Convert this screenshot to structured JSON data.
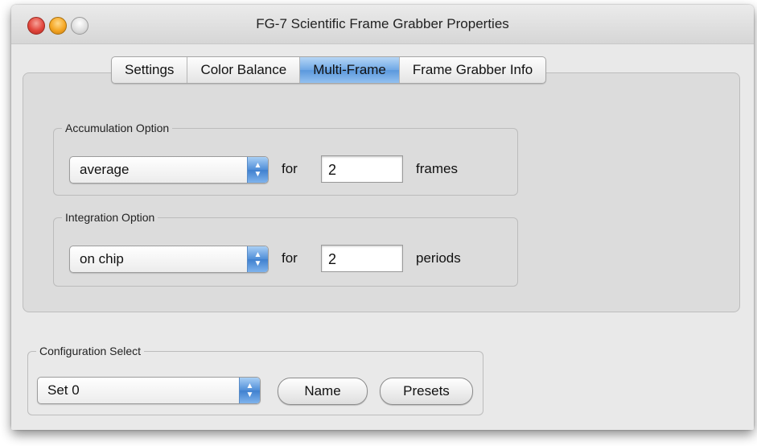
{
  "window": {
    "title": "FG-7 Scientific Frame Grabber Properties"
  },
  "tabs": [
    {
      "label": "Settings",
      "active": false
    },
    {
      "label": "Color Balance",
      "active": false
    },
    {
      "label": "Multi-Frame",
      "active": true
    },
    {
      "label": "Frame Grabber Info",
      "active": false
    }
  ],
  "accumulation": {
    "group_label": "Accumulation Option",
    "selected": "average",
    "for_label": "for",
    "value": "2",
    "unit": "frames"
  },
  "integration": {
    "group_label": "Integration Option",
    "selected": "on chip",
    "for_label": "for",
    "value": "2",
    "unit": "periods"
  },
  "configuration": {
    "group_label": "Configuration Select",
    "selected": "Set 0",
    "name_button": "Name",
    "presets_button": "Presets"
  },
  "colors": {
    "accent": "#5b98dc"
  },
  "icons": {
    "close": "close-icon",
    "minimize": "minimize-icon",
    "zoom": "zoom-icon",
    "popup_arrows": "updown-arrows-icon"
  }
}
